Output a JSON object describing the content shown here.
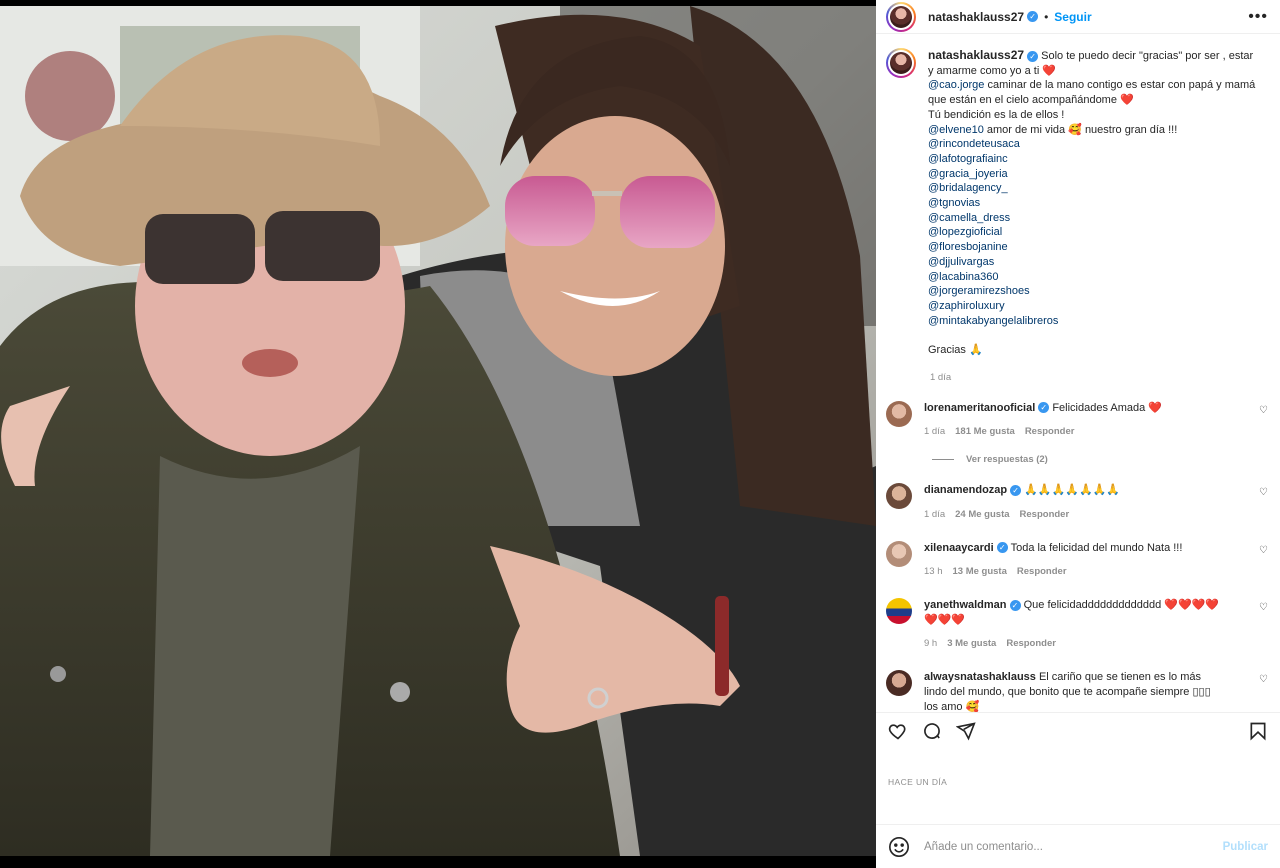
{
  "post": {
    "username": "natashaklauss27",
    "follow_label": "Seguir",
    "more_label": "•••"
  },
  "caption": {
    "username": "natashaklauss27",
    "text_1": "Solo te puedo decir \"gracias\" por ser , estar y amarme como yo a ti ❤️",
    "mention_1": "@cao.jorge",
    "text_2": " caminar de la mano contigo es estar con papá y mamá que están en el cielo acompañándome ❤️",
    "text_3": "Tú bendición es la de ellos !",
    "mention_2": "@elvene10",
    "text_4": " amor de mi vida 🥰 nuestro gran día !!!",
    "mentions": [
      "@rincondeteusaca",
      "@lafotografiainc",
      "@gracia_joyeria",
      "@bridalagency_",
      "@tgnovias",
      "@camella_dress",
      "@lopezgioficial",
      "@floresbojanine",
      "@djjulivargas",
      "@lacabina360",
      "@jorgeramirezshoes",
      "@zaphiroluxury",
      "@mintakabyangelalibreros"
    ],
    "closing": "Gracias 🙏",
    "time": "1 día"
  },
  "comments": [
    {
      "user": "lorenameritanooficial",
      "text": "Felicidades Amada ❤️",
      "time": "1 día",
      "likes": "181 Me gusta",
      "reply": "Responder",
      "verified": true,
      "avatar_color": "#c98f7a"
    },
    {
      "user": "dianamendozap",
      "text": "🙏🙏🙏🙏🙏🙏🙏",
      "time": "1 día",
      "likes": "24 Me gusta",
      "reply": "Responder",
      "verified": true,
      "avatar_color": "#b88a6a"
    },
    {
      "user": "xilenaaycardi",
      "text": "Toda la felicidad del mundo Nata !!!",
      "time": "13 h",
      "likes": "13 Me gusta",
      "reply": "Responder",
      "verified": true,
      "avatar_color": "#d9b7a5"
    },
    {
      "user": "yanethwaldman",
      "text": "Que felicidaddddddddddddd ❤️❤️❤️❤️ ❤️❤️❤️",
      "time": "9 h",
      "likes": "3 Me gusta",
      "reply": "Responder",
      "verified": true,
      "avatar_color": "#1f3d8a"
    },
    {
      "user": "alwaysnatashaklauss",
      "text": "El cariño que se tienen es lo más lindo del mundo, que bonito que te acompañe siempre ▯▯▯ los amo 🥰",
      "verified": false,
      "avatar_color": "#a37060"
    }
  ],
  "view_replies": "Ver respuestas (2)",
  "date_label": "HACE UN DÍA",
  "add_comment": {
    "placeholder": "Añade un comentario...",
    "publish": "Publicar"
  },
  "icons": [
    "heart-icon",
    "comment-icon",
    "share-icon",
    "bookmark-icon",
    "emoji-icon",
    "more-icon"
  ]
}
